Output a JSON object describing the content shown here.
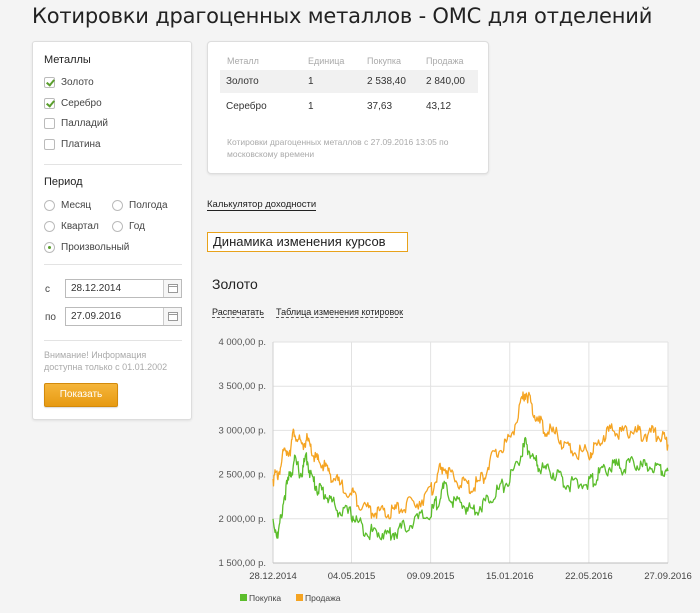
{
  "page": {
    "title": "Котировки драгоценных металлов - ОМС для отделений"
  },
  "filters": {
    "metals_title": "Металлы",
    "metals": [
      {
        "label": "Золото",
        "checked": true
      },
      {
        "label": "Серебро",
        "checked": true
      },
      {
        "label": "Палладий",
        "checked": false
      },
      {
        "label": "Платина",
        "checked": false
      }
    ],
    "period_title": "Период",
    "periods": [
      {
        "label": "Месяц",
        "selected": false
      },
      {
        "label": "Полгода",
        "selected": false
      },
      {
        "label": "Квартал",
        "selected": false
      },
      {
        "label": "Год",
        "selected": false
      },
      {
        "label": "Произвольный",
        "selected": true
      }
    ],
    "from_label": "с",
    "from_value": "28.12.2014",
    "to_label": "по",
    "to_value": "27.09.2016",
    "notice": "Внимание! Информация доступна только с 01.01.2002",
    "show_button": "Показать"
  },
  "quotes": {
    "headers": {
      "metal": "Металл",
      "unit": "Единица",
      "buy": "Покупка",
      "sell": "Продажа"
    },
    "rows": [
      {
        "metal": "Золото",
        "unit": "1",
        "buy": "2 538,40",
        "sell": "2 840,00"
      },
      {
        "metal": "Серебро",
        "unit": "1",
        "buy": "37,63",
        "sell": "43,12"
      }
    ],
    "note": "Котировки драгоценных металлов с 27.09.2016 13:05 по московскому времени"
  },
  "links": {
    "calculator": "Калькулятор доходности",
    "dynamics": "Динамика изменения курсов",
    "print": "Распечатать",
    "table": "Таблица изменения котировок"
  },
  "chart_data": {
    "type": "line",
    "title": "Золото",
    "xlabel": "",
    "ylabel": "",
    "x_ticks": [
      "28.12.2014",
      "04.05.2015",
      "09.09.2015",
      "15.01.2016",
      "22.05.2016",
      "27.09.2016"
    ],
    "y_ticks": [
      "1 500,00 р.",
      "2 000,00 р.",
      "2 500,00 р.",
      "3 000,00 р.",
      "3 500,00 р.",
      "4 000,00 р."
    ],
    "ylim": [
      1500,
      4000
    ],
    "grid": true,
    "legend": "bottom-left",
    "series_colors": {
      "buy": "#5bbd2b",
      "sell": "#f5a422"
    },
    "series": [
      {
        "name": "Покупка",
        "color": "#5bbd2b",
        "points": [
          [
            "28.12.2014",
            2000
          ],
          [
            "05.01.2015",
            1780
          ],
          [
            "15.01.2015",
            2250
          ],
          [
            "25.01.2015",
            2500
          ],
          [
            "01.02.2015",
            2650
          ],
          [
            "12.02.2015",
            2500
          ],
          [
            "20.02.2015",
            2700
          ],
          [
            "01.03.2015",
            2450
          ],
          [
            "10.03.2015",
            2350
          ],
          [
            "20.03.2015",
            2300
          ],
          [
            "01.04.2015",
            2200
          ],
          [
            "15.04.2015",
            2080
          ],
          [
            "04.05.2015",
            2050
          ],
          [
            "15.05.2015",
            1950
          ],
          [
            "01.06.2015",
            1850
          ],
          [
            "15.06.2015",
            1850
          ],
          [
            "01.07.2015",
            1820
          ],
          [
            "15.07.2015",
            1850
          ],
          [
            "01.08.2015",
            1920
          ],
          [
            "20.08.2015",
            2000
          ],
          [
            "09.09.2015",
            2050
          ],
          [
            "20.09.2015",
            2200
          ],
          [
            "01.10.2015",
            2350
          ],
          [
            "15.10.2015",
            2200
          ],
          [
            "01.11.2015",
            2150
          ],
          [
            "15.11.2015",
            2100
          ],
          [
            "01.12.2015",
            2150
          ],
          [
            "15.12.2015",
            2250
          ],
          [
            "01.01.2016",
            2350
          ],
          [
            "15.01.2016",
            2450
          ],
          [
            "01.02.2016",
            2700
          ],
          [
            "10.02.2016",
            2850
          ],
          [
            "20.02.2016",
            2700
          ],
          [
            "01.03.2016",
            2600
          ],
          [
            "15.03.2016",
            2550
          ],
          [
            "01.04.2016",
            2500
          ],
          [
            "15.04.2016",
            2400
          ],
          [
            "01.05.2016",
            2380
          ],
          [
            "22.05.2016",
            2420
          ],
          [
            "01.06.2016",
            2450
          ],
          [
            "15.06.2016",
            2550
          ],
          [
            "01.07.2016",
            2600
          ],
          [
            "15.07.2016",
            2580
          ],
          [
            "01.08.2016",
            2620
          ],
          [
            "15.08.2016",
            2580
          ],
          [
            "01.09.2016",
            2600
          ],
          [
            "15.09.2016",
            2580
          ],
          [
            "27.09.2016",
            2540
          ]
        ]
      },
      {
        "name": "Продажа",
        "color": "#f5a422",
        "points": [
          [
            "28.12.2014",
            2450
          ],
          [
            "05.01.2015",
            2500
          ],
          [
            "15.01.2015",
            2750
          ],
          [
            "25.01.2015",
            2800
          ],
          [
            "01.02.2015",
            3000
          ],
          [
            "12.02.2015",
            2800
          ],
          [
            "20.02.2015",
            2900
          ],
          [
            "01.03.2015",
            2750
          ],
          [
            "10.03.2015",
            2650
          ],
          [
            "20.03.2015",
            2600
          ],
          [
            "01.04.2015",
            2500
          ],
          [
            "15.04.2015",
            2380
          ],
          [
            "04.05.2015",
            2300
          ],
          [
            "15.05.2015",
            2200
          ],
          [
            "01.06.2015",
            2100
          ],
          [
            "15.06.2015",
            2080
          ],
          [
            "01.07.2015",
            2050
          ],
          [
            "15.07.2015",
            2100
          ],
          [
            "01.08.2015",
            2150
          ],
          [
            "20.08.2015",
            2200
          ],
          [
            "09.09.2015",
            2300
          ],
          [
            "20.09.2015",
            2500
          ],
          [
            "01.10.2015",
            2600
          ],
          [
            "15.10.2015",
            2450
          ],
          [
            "01.11.2015",
            2400
          ],
          [
            "15.11.2015",
            2350
          ],
          [
            "01.12.2015",
            2450
          ],
          [
            "15.12.2015",
            2650
          ],
          [
            "01.01.2016",
            2800
          ],
          [
            "15.01.2016",
            2900
          ],
          [
            "01.02.2016",
            3250
          ],
          [
            "10.02.2016",
            3450
          ],
          [
            "20.02.2016",
            3250
          ],
          [
            "01.03.2016",
            3100
          ],
          [
            "15.03.2016",
            3000
          ],
          [
            "01.04.2016",
            2950
          ],
          [
            "15.04.2016",
            2800
          ],
          [
            "01.05.2016",
            2750
          ],
          [
            "22.05.2016",
            2750
          ],
          [
            "01.06.2016",
            2800
          ],
          [
            "15.06.2016",
            2950
          ],
          [
            "01.07.2016",
            3000
          ],
          [
            "15.07.2016",
            2980
          ],
          [
            "01.08.2016",
            3000
          ],
          [
            "15.08.2016",
            2950
          ],
          [
            "01.09.2016",
            2970
          ],
          [
            "15.09.2016",
            2950
          ],
          [
            "27.09.2016",
            2840
          ]
        ]
      }
    ]
  }
}
